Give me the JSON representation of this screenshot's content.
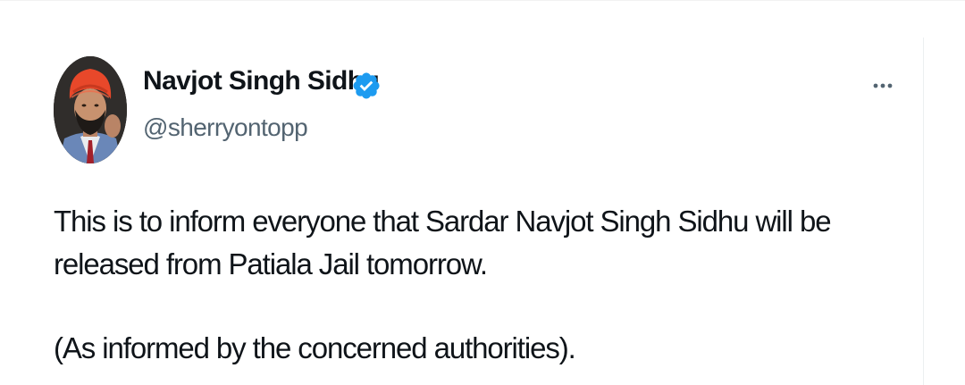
{
  "author": {
    "display_name": "Navjot Singh Sidhu",
    "handle": "@sherryontopp",
    "verified": true,
    "verified_color": "#1d9bf0"
  },
  "menu": {
    "more_icon": "more-horizontal-icon"
  },
  "tweet": {
    "line1": "This is to inform everyone that Sardar Navjot Singh Sidhu will be",
    "line2": "released from Patiala Jail tomorrow.",
    "line3": "(As informed by the concerned authorities)."
  },
  "colors": {
    "text_primary": "#0f1419",
    "text_secondary": "#536471",
    "turban": "#e8482a"
  }
}
